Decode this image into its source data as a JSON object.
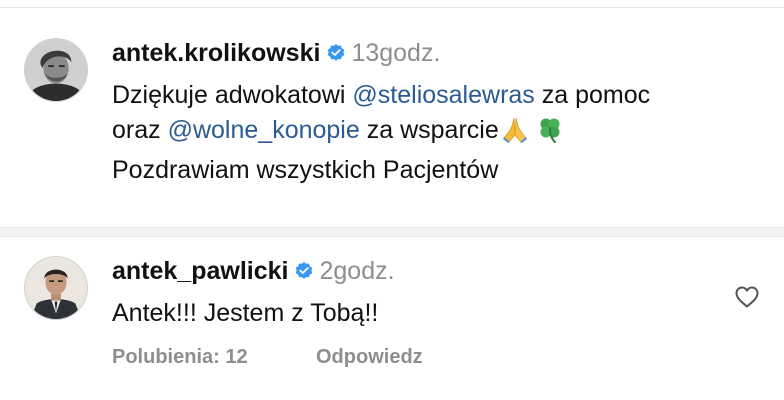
{
  "comments": [
    {
      "username": "antek.krolikowski",
      "verified_icon": "verified-badge-icon",
      "time": "13godz.",
      "line1": {
        "prefix": "Dziękuje adwokatowi ",
        "mention": "@steliosalewras",
        "suffix": " za pomoc"
      },
      "line2": {
        "prefix": "oraz ",
        "mention": "@wolne_konopie",
        "suffix": " za wsparcie"
      },
      "line3": "Pozdrawiam wszystkich Pacjentów",
      "emojis": [
        "folded-hands-icon",
        "four-leaf-clover-icon"
      ]
    },
    {
      "username": "antek_pawlicki",
      "verified_icon": "verified-badge-icon",
      "time": "2godz.",
      "text": "Antek!!! Jestem z Tobą!!",
      "likes_label": "Polubienia: 12",
      "reply_label": "Odpowiedz",
      "like_icon": "heart-outline-icon"
    }
  ],
  "colors": {
    "mention": "#2b5b94",
    "verified": "#3897f0",
    "muted": "#8e8e8e",
    "text": "#111111"
  }
}
